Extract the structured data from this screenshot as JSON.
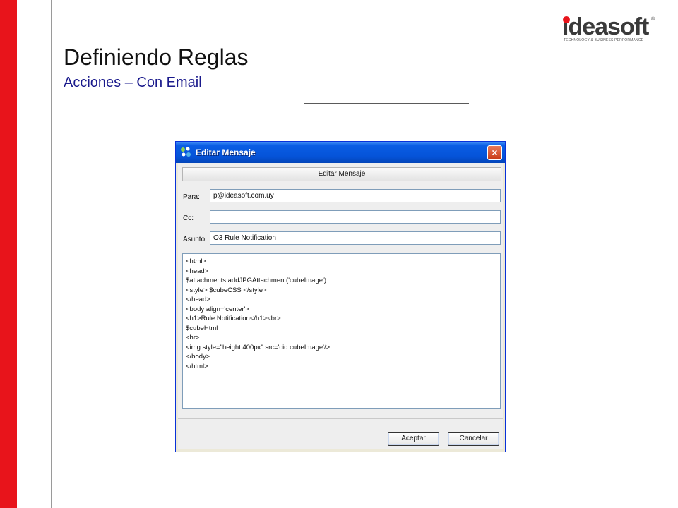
{
  "slide": {
    "title": "Definiendo Reglas",
    "subtitle": "Acciones – Con Email",
    "accent_color": "#e8141b"
  },
  "logo": {
    "word": "ideasoft",
    "registered": "®",
    "tagline": "TECHNOLOGY & BUSINESS PERFORMANCE"
  },
  "dialog": {
    "title": "Editar Mensaje",
    "header": "Editar Mensaje",
    "close_icon": "×",
    "fields": {
      "para_label": "Para:",
      "para_value": "p@ideasoft.com.uy",
      "cc_label": "Cc:",
      "cc_value": "",
      "asunto_label": "Asunto:",
      "asunto_value": "O3 Rule Notification"
    },
    "body_lines": [
      "<html>",
      "<head>",
      "$attachments.addJPGAttachment('cubeImage')",
      "<style> $cubeCSS </style>",
      "</head>",
      "<body align='center'>",
      "<h1>Rule Notification</h1><br>",
      "$cubeHtml",
      "<hr>",
      "<img style=\"height:400px\" src='cid:cubeImage'/>",
      "</body>",
      "</html>"
    ],
    "buttons": {
      "accept": "Aceptar",
      "cancel": "Cancelar"
    }
  }
}
